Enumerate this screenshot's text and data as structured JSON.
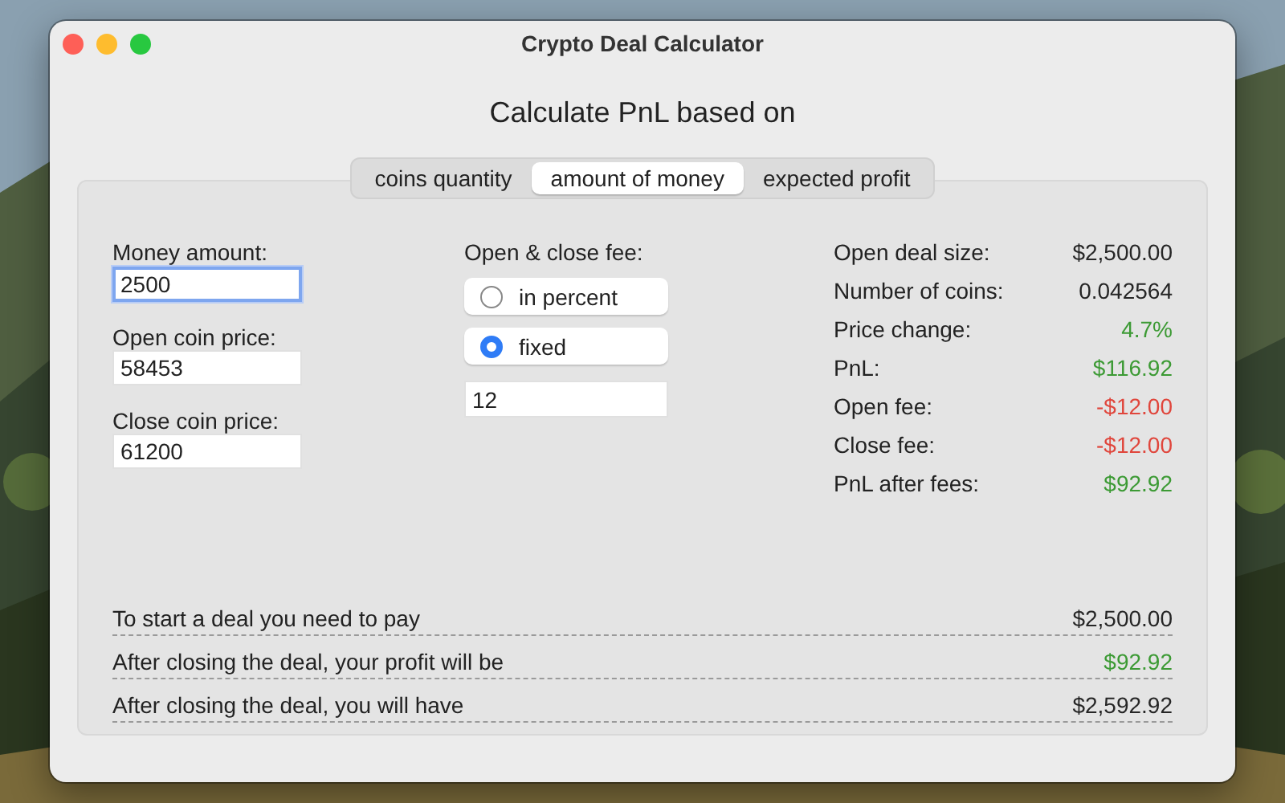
{
  "window": {
    "title": "Crypto Deal Calculator"
  },
  "heading": "Calculate PnL based on",
  "tabs": [
    {
      "label": "coins quantity",
      "selected": false
    },
    {
      "label": "amount of money",
      "selected": true
    },
    {
      "label": "expected profit",
      "selected": false
    }
  ],
  "fields": [
    {
      "label": "Money amount:",
      "value": "2500",
      "focused": true
    },
    {
      "label": "Open coin price:",
      "value": "58453",
      "focused": false
    },
    {
      "label": "Close coin price:",
      "value": "61200",
      "focused": false
    }
  ],
  "fee": {
    "label": "Open & close fee:",
    "options": [
      {
        "label": "in percent",
        "selected": false
      },
      {
        "label": "fixed",
        "selected": true
      }
    ],
    "value": "12"
  },
  "results": [
    {
      "label": "Open deal size:",
      "value": "$2,500.00",
      "color": "#262626"
    },
    {
      "label": "Number of coins:",
      "value": "0.042564",
      "color": "#262626"
    },
    {
      "label": "Price change:",
      "value": "4.7%",
      "color": "#3c9a34"
    },
    {
      "label": "PnL:",
      "value": "$116.92",
      "color": "#3c9a34"
    },
    {
      "label": "Open fee:",
      "value": "-$12.00",
      "color": "#e0463c"
    },
    {
      "label": "Close fee:",
      "value": "-$12.00",
      "color": "#e0463c"
    },
    {
      "label": "PnL after fees:",
      "value": "$92.92",
      "color": "#3c9a34"
    }
  ],
  "summary": [
    {
      "label": "To start a deal you need to pay",
      "value": "$2,500.00",
      "color": "#262626"
    },
    {
      "label": "After closing the deal, your profit will be",
      "value": "$92.92",
      "color": "#3c9a34"
    },
    {
      "label": "After closing the deal, you will have",
      "value": "$2,592.92",
      "color": "#262626"
    }
  ]
}
